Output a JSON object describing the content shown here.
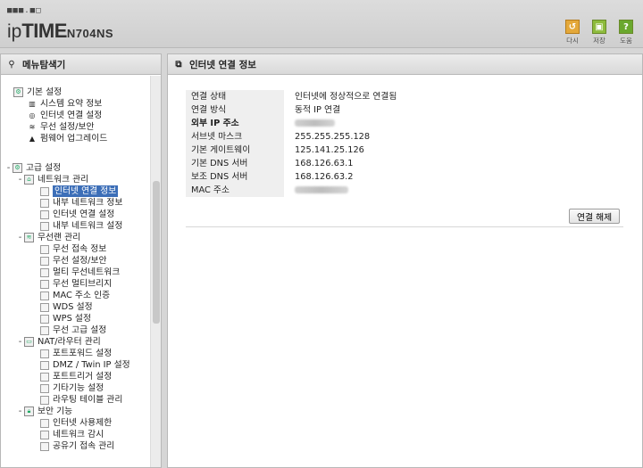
{
  "header": {
    "logo_dots": "■■■.■□",
    "logo_ip": "ip",
    "logo_time": "TIME",
    "logo_model": "N704NS",
    "buttons": [
      {
        "label": "다시",
        "icon": "refresh-icon",
        "glyph": "↺"
      },
      {
        "label": "저장",
        "icon": "save-icon",
        "glyph": "▣"
      },
      {
        "label": "도움",
        "icon": "help-icon",
        "glyph": "?"
      }
    ]
  },
  "sidebar": {
    "title": "메뉴탐색기",
    "items": [
      {
        "label": "기본 설정"
      },
      {
        "label": "시스템 요약 정보"
      },
      {
        "label": "인터넷 연결 설정"
      },
      {
        "label": "무선 설정/보안"
      },
      {
        "label": "펌웨어 업그레이드"
      },
      {
        "label": "고급 설정"
      },
      {
        "label": "네트워크 관리"
      },
      {
        "label": "인터넷 연결 정보"
      },
      {
        "label": "내부 네트워크 정보"
      },
      {
        "label": "인터넷 연결 설정"
      },
      {
        "label": "내부 네트워크 설정"
      },
      {
        "label": "무선랜 관리"
      },
      {
        "label": "무선 접속 정보"
      },
      {
        "label": "무선 설정/보안"
      },
      {
        "label": "멀티 무선네트워크"
      },
      {
        "label": "무선 멀티브리지"
      },
      {
        "label": "MAC 주소 인증"
      },
      {
        "label": "WDS 설정"
      },
      {
        "label": "WPS 설정"
      },
      {
        "label": "무선 고급 설정"
      },
      {
        "label": "NAT/라우터 관리"
      },
      {
        "label": "포트포워드 설정"
      },
      {
        "label": "DMZ / Twin IP 설정"
      },
      {
        "label": "포트트리거 설정"
      },
      {
        "label": "기타기능 설정"
      },
      {
        "label": "라우팅 테이블 관리"
      },
      {
        "label": "보안 기능"
      },
      {
        "label": "인터넷 사용제한"
      },
      {
        "label": "네트워크 감시"
      },
      {
        "label": "공유기 접속 관리"
      }
    ]
  },
  "main": {
    "title": "인터넷 연결 정보",
    "rows": [
      {
        "key": "연결 상태",
        "value": "인터넷에 정상적으로 연결됨"
      },
      {
        "key": "연결 방식",
        "value": "동적 IP 연결"
      },
      {
        "key": "외부 IP 주소",
        "value": ""
      },
      {
        "key": "서브넷 마스크",
        "value": "255.255.255.128"
      },
      {
        "key": "기본 게이트웨이",
        "value": "125.141.25.126"
      },
      {
        "key": "기본 DNS 서버",
        "value": "168.126.63.1"
      },
      {
        "key": "보조 DNS 서버",
        "value": "168.126.63.2"
      },
      {
        "key": "MAC 주소",
        "value": ""
      }
    ],
    "disconnect_label": "연결 해제"
  }
}
